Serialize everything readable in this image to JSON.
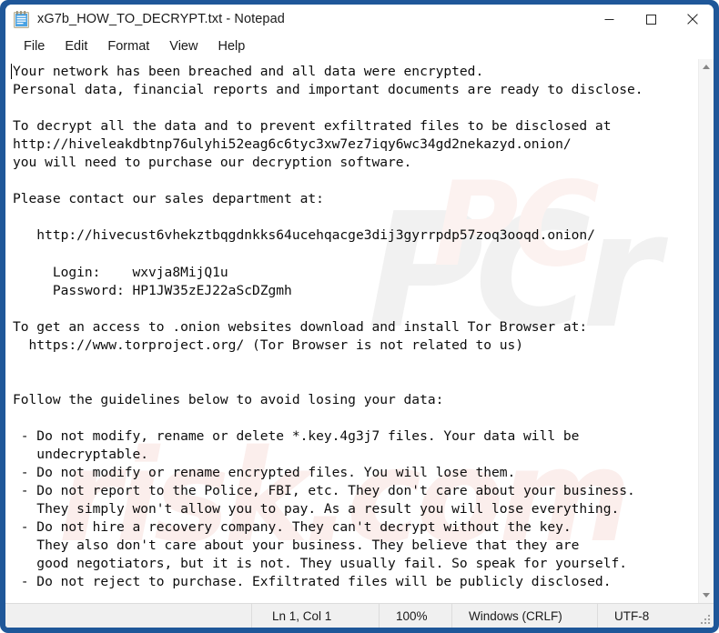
{
  "window": {
    "title": "xG7b_HOW_TO_DECRYPT.txt - Notepad",
    "icon": "notepad-icon",
    "border_color": "#1f5799",
    "controls": {
      "minimize": "minimize-icon",
      "maximize": "maximize-icon",
      "close": "close-icon"
    }
  },
  "menubar": {
    "items": [
      {
        "label": "File"
      },
      {
        "label": "Edit"
      },
      {
        "label": "Format"
      },
      {
        "label": "View"
      },
      {
        "label": "Help"
      }
    ]
  },
  "document": {
    "body": "Your network has been breached and all data were encrypted.\nPersonal data, financial reports and important documents are ready to disclose.\n\nTo decrypt all the data and to prevent exfiltrated files to be disclosed at\nhttp://hiveleakdbtnp76ulyhi52eag6c6tyc3xw7ez7iqy6wc34gd2nekazyd.onion/\nyou will need to purchase our decryption software.\n\nPlease contact our sales department at:\n\n   http://hivecust6vhekztbqgdnkks64ucehqacge3dij3gyrrpdp57zoq3ooqd.onion/\n\n     Login:    wxvja8MijQ1u\n     Password: HP1JW35zEJ22aScDZgmh\n\nTo get an access to .onion websites download and install Tor Browser at:\n  https://www.torproject.org/ (Tor Browser is not related to us)\n\n\nFollow the guidelines below to avoid losing your data:\n\n - Do not modify, rename or delete *.key.4g3j7 files. Your data will be\n   undecryptable.\n - Do not modify or rename encrypted files. You will lose them.\n - Do not report to the Police, FBI, etc. They don't care about your business.\n   They simply won't allow you to pay. As a result you will lose everything.\n - Do not hire a recovery company. They can't decrypt without the key.\n   They also don't care about your business. They believe that they are\n   good negotiators, but it is not. They usually fail. So speak for yourself.\n - Do not reject to purchase. Exfiltrated files will be publicly disclosed."
  },
  "watermarks": {
    "grey": "PCr",
    "pink_lower": "risk.com",
    "pink_upper": "PC"
  },
  "scrollbar": {
    "up_arrow": "scroll-up-arrow-icon",
    "down_arrow": "scroll-down-arrow-icon"
  },
  "statusbar": {
    "cursor_position": "Ln 1, Col 1",
    "zoom": "100%",
    "line_ending": "Windows (CRLF)",
    "encoding": "UTF-8"
  }
}
